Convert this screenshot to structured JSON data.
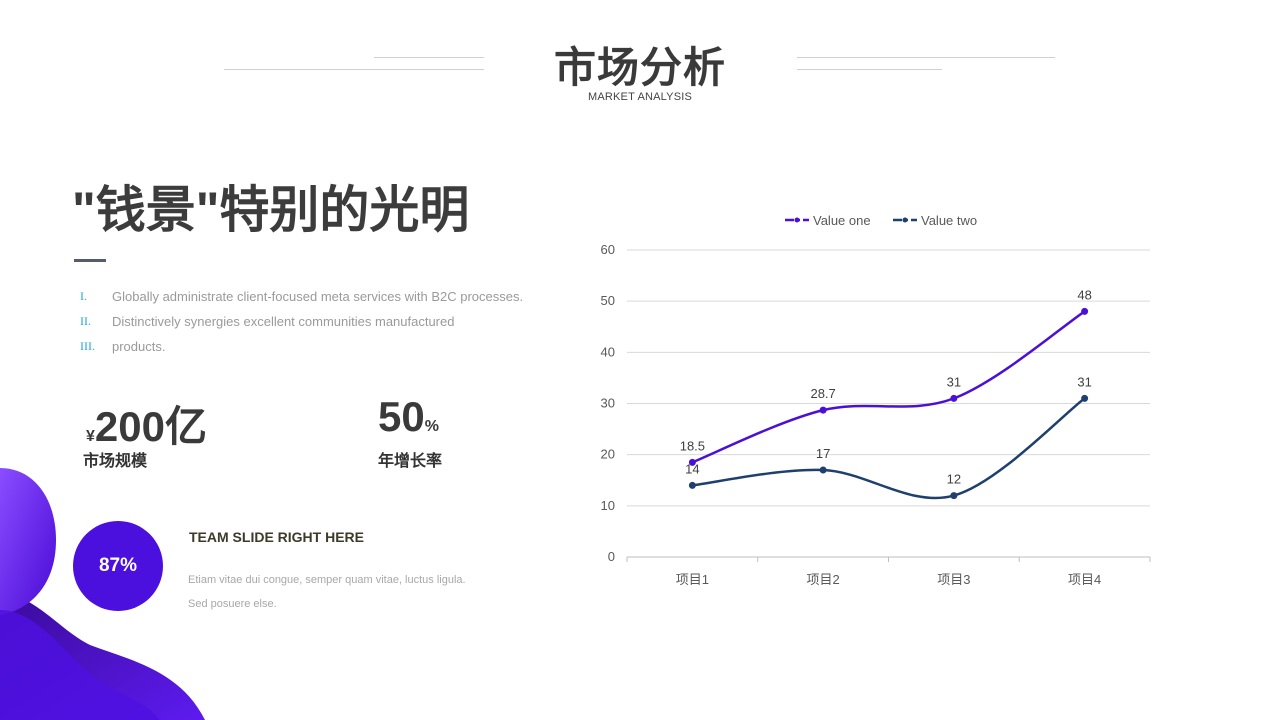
{
  "header": {
    "title": "市场分析",
    "subtitle": "MARKET ANALYSIS"
  },
  "headline": "\"钱景\"特别的光明",
  "list": [
    {
      "num": "I.",
      "text": "Globally administrate client-focused meta services with B2C processes."
    },
    {
      "num": "II.",
      "text": "Distinctively synergies excellent communities manufactured"
    },
    {
      "num": "III.",
      "text": "products."
    }
  ],
  "stats": {
    "market": {
      "prefix": "¥",
      "value": "200亿",
      "label": "市场规模"
    },
    "growth": {
      "value": "50",
      "suffix": "%",
      "label": "年增长率"
    }
  },
  "team": {
    "percent": "87%",
    "title": "TEAM SLIDE RIGHT HERE",
    "text": "Etiam vitae dui congue, semper quam vitae, luctus ligula. Sed posuere else."
  },
  "colors": {
    "series_one": "#4b10d6",
    "series_two": "#1f3f6e",
    "accent_purple": "#5a17f0",
    "list_number": "#26a7d8"
  },
  "chart_data": {
    "type": "line",
    "categories": [
      "项目1",
      "项目2",
      "项目3",
      "项目4"
    ],
    "series": [
      {
        "name": "Value one",
        "values": [
          18.5,
          28.7,
          31,
          48
        ],
        "labels": [
          "18.5",
          "28.7",
          "31",
          "48"
        ],
        "color": "#4b10d6"
      },
      {
        "name": "Value two",
        "values": [
          14,
          17,
          12,
          31
        ],
        "labels": [
          "14",
          "17",
          "12",
          "31"
        ],
        "color": "#1f3f6e"
      }
    ],
    "ylim": [
      0,
      60
    ],
    "yticks": [
      0,
      10,
      20,
      30,
      40,
      50,
      60
    ],
    "grid": true,
    "legend": "top-center",
    "smooth": true
  }
}
